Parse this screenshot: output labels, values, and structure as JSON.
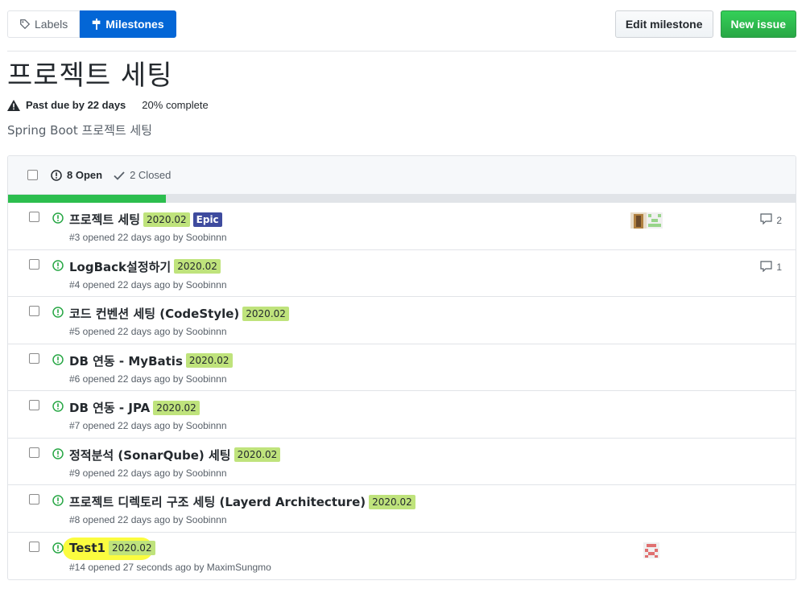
{
  "subnav": {
    "labels": "Labels",
    "milestones": "Milestones"
  },
  "actions": {
    "edit": "Edit milestone",
    "new_issue": "New issue"
  },
  "milestone": {
    "title": "프로젝트 세팅",
    "due": "Past due by 22 days",
    "progress_percent": "20%",
    "progress_suffix": "complete",
    "progress_fraction": 0.2,
    "description": "Spring Boot 프로젝트 세팅"
  },
  "states": {
    "open": "8 Open",
    "closed": "2 Closed"
  },
  "colors": {
    "milestone_label": "#bfe37c",
    "epic_label": "#3e4b9e",
    "open_green": "#28a745",
    "progress_green": "#2cbe4e",
    "primary_blue": "#0366d6"
  },
  "issues": [
    {
      "title": "프로젝트 세팅",
      "labels": [
        "2020.02",
        "Epic"
      ],
      "meta": "#3 opened 22 days ago by Soobinnn",
      "comments": "2",
      "avatars": 2
    },
    {
      "title": "LogBack설정하기",
      "labels": [
        "2020.02"
      ],
      "meta": "#4 opened 22 days ago by Soobinnn",
      "comments": "1",
      "avatars": 0
    },
    {
      "title": "코드 컨벤션 세팅 (CodeStyle)",
      "labels": [
        "2020.02"
      ],
      "meta": "#5 opened 22 days ago by Soobinnn",
      "comments": "",
      "avatars": 0
    },
    {
      "title": "DB 연동 - MyBatis",
      "labels": [
        "2020.02"
      ],
      "meta": "#6 opened 22 days ago by Soobinnn",
      "comments": "",
      "avatars": 0
    },
    {
      "title": "DB 연동 - JPA",
      "labels": [
        "2020.02"
      ],
      "meta": "#7 opened 22 days ago by Soobinnn",
      "comments": "",
      "avatars": 0
    },
    {
      "title": "정적분석 (SonarQube) 세팅",
      "labels": [
        "2020.02"
      ],
      "meta": "#9 opened 22 days ago by Soobinnn",
      "comments": "",
      "avatars": 0
    },
    {
      "title": "프로젝트 디렉토리 구조 세팅 (Layerd Architecture)",
      "labels": [
        "2020.02"
      ],
      "meta": "#8 opened 22 days ago by Soobinnn",
      "comments": "",
      "avatars": 0
    },
    {
      "title": "Test1",
      "labels": [
        "2020.02"
      ],
      "meta": "#14 opened 27 seconds ago by MaximSungmo",
      "comments": "",
      "avatars": 1
    }
  ]
}
